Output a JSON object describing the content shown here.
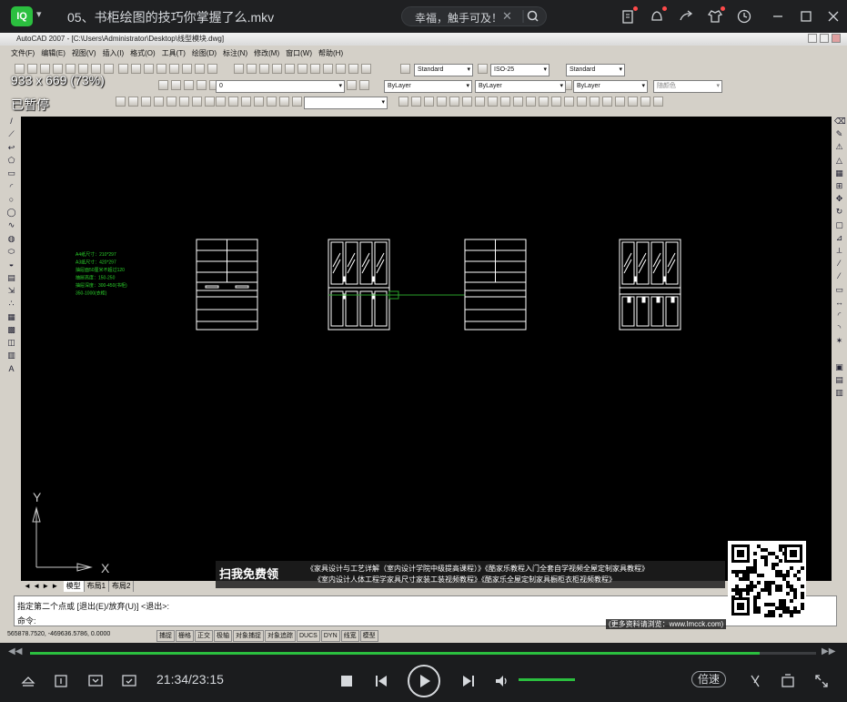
{
  "player": {
    "logo_text": "IQ",
    "file_title": "05、书柜绘图的技巧你掌握了么.mkv",
    "search_text": "幸福，触手可及！",
    "current_time": "21:34/23:15",
    "speed_label": "倍速",
    "progress_fraction": 0.9285,
    "volume_fraction": 1.0,
    "accent_color": "#2bbf3f",
    "icons": [
      "clipboard-icon",
      "notification-icon",
      "share-icon",
      "shirt-icon",
      "clock-icon",
      "minimize-icon",
      "maximize-icon",
      "close-icon"
    ]
  },
  "acad": {
    "window_title": "AutoCAD 2007 - [C:\\Users\\Administrator\\Desktop\\线型模块.dwg]",
    "menu": [
      "文件(F)",
      "编辑(E)",
      "视图(V)",
      "插入(I)",
      "格式(O)",
      "工具(T)",
      "绘图(D)",
      "标注(N)",
      "修改(M)",
      "窗口(W)",
      "帮助(H)"
    ],
    "combos": {
      "text_style": "Standard",
      "dim_style": "ISO-25",
      "table_style": "Standard",
      "layer": "0",
      "color": "ByLayer",
      "linetype": "ByLayer",
      "lineweight": "ByLayer",
      "plot_style": "随颜色"
    },
    "overlay_size": "933 x 669 (73%)",
    "overlay_paused": "已暂停",
    "layout_tabs": [
      "模型",
      "布局1",
      "布局2"
    ],
    "command_line1": "指定第二个点或 [退出(E)/放弃(U)] <退出>:",
    "command_line2": "命令:",
    "coords": "565878.7520, -469636.5786, 0.0000",
    "status_toggles": [
      "捕捉",
      "栅格",
      "正交",
      "极轴",
      "对象捕捉",
      "对象追踪",
      "DUCS",
      "DYN",
      "线宽",
      "模型"
    ],
    "axis_y": "Y",
    "axis_x": "X",
    "notes": [
      "A4纸尺寸：210*297",
      "A3纸尺寸：420*297",
      "抽屉面50厘米不超过120",
      "抽屉高度：150-250",
      "抽屉深度：300-450(书柜)",
      "              350-1000(衣柜)"
    ]
  },
  "promo": {
    "button": "扫我免费领",
    "line1": "《家具设计与工艺详解（室内设计学院中级提高课程）》《酷家乐教程入门全套自学视频全屋定制家具教程》",
    "line2": "《室内设计人体工程学家具尺寸家装工装视频教程》《酷家乐全屋定制家具橱柜衣柜视频教程》",
    "site": "(更多资料请浏览：www.lmcck.com)"
  }
}
